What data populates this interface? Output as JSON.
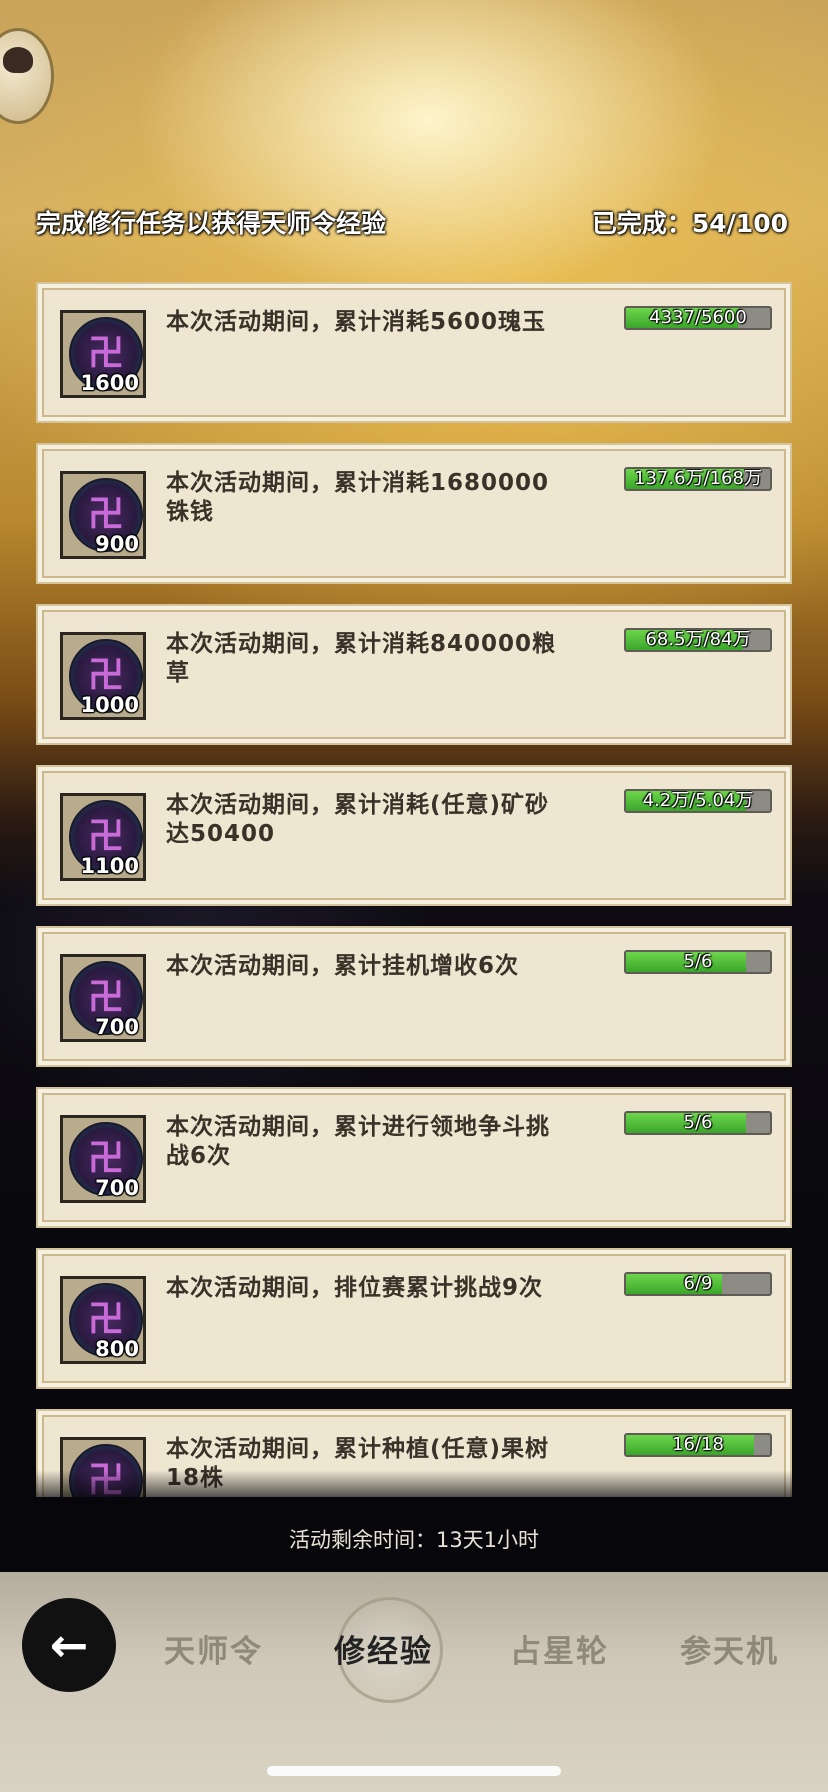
{
  "header": {
    "title": "完成修行任务以获得天师令经验",
    "completed": "已完成：54/100"
  },
  "tasks": [
    {
      "desc": "本次活动期间，累计消耗5600瑰玉",
      "reward": "1600",
      "progress_text": "4337/5600",
      "progress": 0.7745
    },
    {
      "desc": "本次活动期间，累计消耗1680000铢钱",
      "reward": "900",
      "progress_text": "137.6万/168万",
      "progress": 0.819
    },
    {
      "desc": "本次活动期间，累计消耗840000粮草",
      "reward": "1000",
      "progress_text": "68.5万/84万",
      "progress": 0.8155
    },
    {
      "desc": "本次活动期间，累计消耗(任意)矿砂达50400",
      "reward": "1100",
      "progress_text": "4.2万/5.04万",
      "progress": 0.8333
    },
    {
      "desc": "本次活动期间，累计挂机增收6次",
      "reward": "700",
      "progress_text": "5/6",
      "progress": 0.8333
    },
    {
      "desc": "本次活动期间，累计进行领地争斗挑战6次",
      "reward": "700",
      "progress_text": "5/6",
      "progress": 0.8333
    },
    {
      "desc": "本次活动期间，排位赛累计挑战9次",
      "reward": "800",
      "progress_text": "6/9",
      "progress": 0.6667
    },
    {
      "desc": "本次活动期间，累计种植(任意)果树18株",
      "reward": "",
      "progress_text": "16/18",
      "progress": 0.8889
    }
  ],
  "remaining_time": "活动剩余时间：13天1小时",
  "nav": {
    "back_icon": "left-arrow-icon",
    "tabs": [
      {
        "label": "天师令",
        "active": false
      },
      {
        "label": "修经验",
        "active": true
      },
      {
        "label": "占星轮",
        "active": false
      },
      {
        "label": "参天机",
        "active": false
      }
    ]
  },
  "colors": {
    "progress_fill": "#4fbf37",
    "card_bg": "#efe6d2",
    "active_tab": "#222222",
    "inactive_tab": "#8f897c"
  }
}
